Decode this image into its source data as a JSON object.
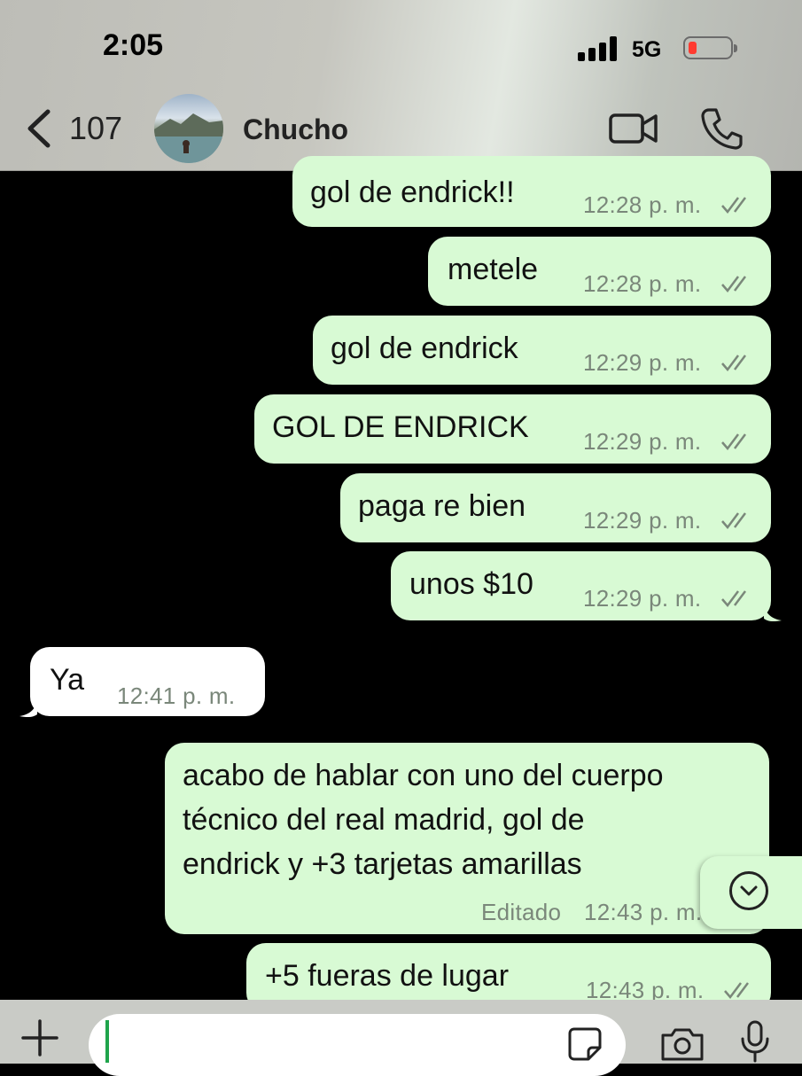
{
  "status_bar": {
    "time": "2:05",
    "network": "5G"
  },
  "header": {
    "back_count": "107",
    "contact_name": "Chucho"
  },
  "messages": [
    {
      "text": "gol de endrick!!",
      "time": "12:28 p. m."
    },
    {
      "text": "metele",
      "time": "12:28 p. m."
    },
    {
      "text": "gol de endrick",
      "time": "12:29 p. m."
    },
    {
      "text": "GOL DE ENDRICK",
      "time": "12:29 p. m."
    },
    {
      "text": "paga re bien",
      "time": "12:29 p. m."
    },
    {
      "text": "unos $10",
      "time": "12:29 p. m."
    },
    {
      "text": "Ya",
      "time": "12:41 p. m."
    },
    {
      "lines": [
        "acabo de hablar con uno del cuerpo",
        "técnico del real madrid, gol de",
        "endrick y +3 tarjetas amarillas"
      ],
      "edited": "Editado",
      "time": "12:43 p. m."
    },
    {
      "text": "+5 fueras de lugar",
      "time": "12:43 p. m."
    }
  ],
  "colors": {
    "outgoing_bubble": "#d8fad4",
    "incoming_bubble": "#ffffff",
    "background": "#000000",
    "caret": "#1fa44b"
  },
  "icons": [
    "back-chevron-icon",
    "video-call-icon",
    "phone-icon",
    "chevron-down-icon",
    "plus-icon",
    "sticker-icon",
    "camera-icon",
    "microphone-icon"
  ]
}
